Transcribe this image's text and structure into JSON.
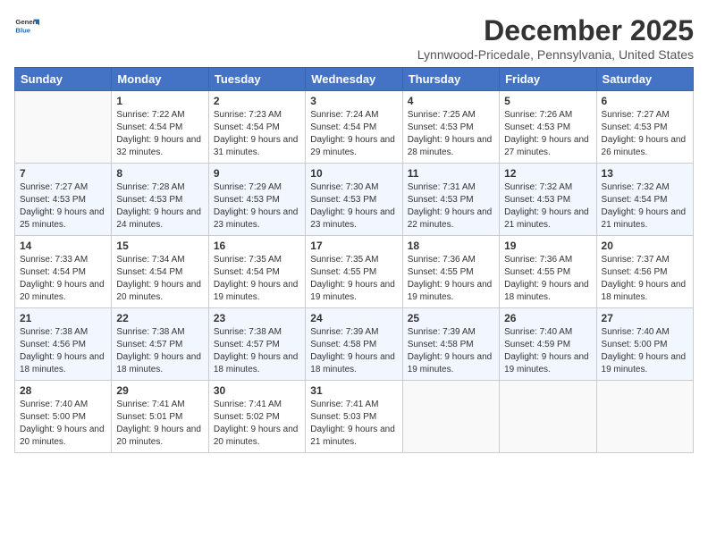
{
  "header": {
    "logo": {
      "general": "General",
      "blue": "Blue"
    },
    "title": "December 2025",
    "subtitle": "Lynnwood-Pricedale, Pennsylvania, United States"
  },
  "calendar": {
    "headers": [
      "Sunday",
      "Monday",
      "Tuesday",
      "Wednesday",
      "Thursday",
      "Friday",
      "Saturday"
    ],
    "weeks": [
      [
        {
          "day": "",
          "sunrise": "",
          "sunset": "",
          "daylight": ""
        },
        {
          "day": "1",
          "sunrise": "Sunrise: 7:22 AM",
          "sunset": "Sunset: 4:54 PM",
          "daylight": "Daylight: 9 hours and 32 minutes."
        },
        {
          "day": "2",
          "sunrise": "Sunrise: 7:23 AM",
          "sunset": "Sunset: 4:54 PM",
          "daylight": "Daylight: 9 hours and 31 minutes."
        },
        {
          "day": "3",
          "sunrise": "Sunrise: 7:24 AM",
          "sunset": "Sunset: 4:54 PM",
          "daylight": "Daylight: 9 hours and 29 minutes."
        },
        {
          "day": "4",
          "sunrise": "Sunrise: 7:25 AM",
          "sunset": "Sunset: 4:53 PM",
          "daylight": "Daylight: 9 hours and 28 minutes."
        },
        {
          "day": "5",
          "sunrise": "Sunrise: 7:26 AM",
          "sunset": "Sunset: 4:53 PM",
          "daylight": "Daylight: 9 hours and 27 minutes."
        },
        {
          "day": "6",
          "sunrise": "Sunrise: 7:27 AM",
          "sunset": "Sunset: 4:53 PM",
          "daylight": "Daylight: 9 hours and 26 minutes."
        }
      ],
      [
        {
          "day": "7",
          "sunrise": "Sunrise: 7:27 AM",
          "sunset": "Sunset: 4:53 PM",
          "daylight": "Daylight: 9 hours and 25 minutes."
        },
        {
          "day": "8",
          "sunrise": "Sunrise: 7:28 AM",
          "sunset": "Sunset: 4:53 PM",
          "daylight": "Daylight: 9 hours and 24 minutes."
        },
        {
          "day": "9",
          "sunrise": "Sunrise: 7:29 AM",
          "sunset": "Sunset: 4:53 PM",
          "daylight": "Daylight: 9 hours and 23 minutes."
        },
        {
          "day": "10",
          "sunrise": "Sunrise: 7:30 AM",
          "sunset": "Sunset: 4:53 PM",
          "daylight": "Daylight: 9 hours and 23 minutes."
        },
        {
          "day": "11",
          "sunrise": "Sunrise: 7:31 AM",
          "sunset": "Sunset: 4:53 PM",
          "daylight": "Daylight: 9 hours and 22 minutes."
        },
        {
          "day": "12",
          "sunrise": "Sunrise: 7:32 AM",
          "sunset": "Sunset: 4:53 PM",
          "daylight": "Daylight: 9 hours and 21 minutes."
        },
        {
          "day": "13",
          "sunrise": "Sunrise: 7:32 AM",
          "sunset": "Sunset: 4:54 PM",
          "daylight": "Daylight: 9 hours and 21 minutes."
        }
      ],
      [
        {
          "day": "14",
          "sunrise": "Sunrise: 7:33 AM",
          "sunset": "Sunset: 4:54 PM",
          "daylight": "Daylight: 9 hours and 20 minutes."
        },
        {
          "day": "15",
          "sunrise": "Sunrise: 7:34 AM",
          "sunset": "Sunset: 4:54 PM",
          "daylight": "Daylight: 9 hours and 20 minutes."
        },
        {
          "day": "16",
          "sunrise": "Sunrise: 7:35 AM",
          "sunset": "Sunset: 4:54 PM",
          "daylight": "Daylight: 9 hours and 19 minutes."
        },
        {
          "day": "17",
          "sunrise": "Sunrise: 7:35 AM",
          "sunset": "Sunset: 4:55 PM",
          "daylight": "Daylight: 9 hours and 19 minutes."
        },
        {
          "day": "18",
          "sunrise": "Sunrise: 7:36 AM",
          "sunset": "Sunset: 4:55 PM",
          "daylight": "Daylight: 9 hours and 19 minutes."
        },
        {
          "day": "19",
          "sunrise": "Sunrise: 7:36 AM",
          "sunset": "Sunset: 4:55 PM",
          "daylight": "Daylight: 9 hours and 18 minutes."
        },
        {
          "day": "20",
          "sunrise": "Sunrise: 7:37 AM",
          "sunset": "Sunset: 4:56 PM",
          "daylight": "Daylight: 9 hours and 18 minutes."
        }
      ],
      [
        {
          "day": "21",
          "sunrise": "Sunrise: 7:38 AM",
          "sunset": "Sunset: 4:56 PM",
          "daylight": "Daylight: 9 hours and 18 minutes."
        },
        {
          "day": "22",
          "sunrise": "Sunrise: 7:38 AM",
          "sunset": "Sunset: 4:57 PM",
          "daylight": "Daylight: 9 hours and 18 minutes."
        },
        {
          "day": "23",
          "sunrise": "Sunrise: 7:38 AM",
          "sunset": "Sunset: 4:57 PM",
          "daylight": "Daylight: 9 hours and 18 minutes."
        },
        {
          "day": "24",
          "sunrise": "Sunrise: 7:39 AM",
          "sunset": "Sunset: 4:58 PM",
          "daylight": "Daylight: 9 hours and 18 minutes."
        },
        {
          "day": "25",
          "sunrise": "Sunrise: 7:39 AM",
          "sunset": "Sunset: 4:58 PM",
          "daylight": "Daylight: 9 hours and 19 minutes."
        },
        {
          "day": "26",
          "sunrise": "Sunrise: 7:40 AM",
          "sunset": "Sunset: 4:59 PM",
          "daylight": "Daylight: 9 hours and 19 minutes."
        },
        {
          "day": "27",
          "sunrise": "Sunrise: 7:40 AM",
          "sunset": "Sunset: 5:00 PM",
          "daylight": "Daylight: 9 hours and 19 minutes."
        }
      ],
      [
        {
          "day": "28",
          "sunrise": "Sunrise: 7:40 AM",
          "sunset": "Sunset: 5:00 PM",
          "daylight": "Daylight: 9 hours and 20 minutes."
        },
        {
          "day": "29",
          "sunrise": "Sunrise: 7:41 AM",
          "sunset": "Sunset: 5:01 PM",
          "daylight": "Daylight: 9 hours and 20 minutes."
        },
        {
          "day": "30",
          "sunrise": "Sunrise: 7:41 AM",
          "sunset": "Sunset: 5:02 PM",
          "daylight": "Daylight: 9 hours and 20 minutes."
        },
        {
          "day": "31",
          "sunrise": "Sunrise: 7:41 AM",
          "sunset": "Sunset: 5:03 PM",
          "daylight": "Daylight: 9 hours and 21 minutes."
        },
        {
          "day": "",
          "sunrise": "",
          "sunset": "",
          "daylight": ""
        },
        {
          "day": "",
          "sunrise": "",
          "sunset": "",
          "daylight": ""
        },
        {
          "day": "",
          "sunrise": "",
          "sunset": "",
          "daylight": ""
        }
      ]
    ]
  }
}
